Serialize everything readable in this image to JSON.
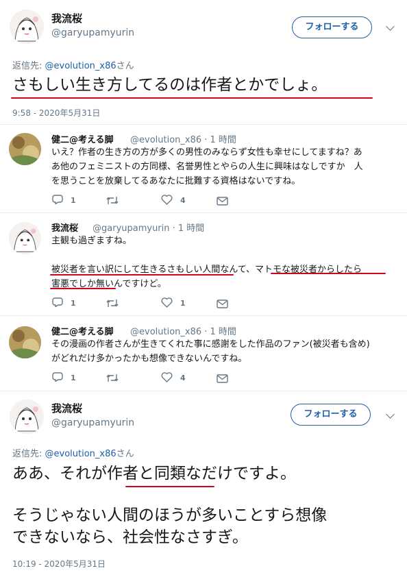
{
  "tweet1": {
    "name": "我流桜",
    "handle": "@garyupamyurin",
    "follow_label": "フォローする",
    "reply_prefix": "返信先: ",
    "reply_mention": "@evolution_x86",
    "reply_suffix": "さん",
    "text": "さもしい生き方してるのは作者とかでしょ。",
    "timestamp": "9:58 - 2020年5月31日"
  },
  "replies": [
    {
      "name": "健二@考える脚",
      "meta": "@evolution_x86 · 1 時間",
      "text": "いえ？作者の生き方の方が多くの男性のみならず女性も幸せにしてますね？あ\nあ他のフェミニストの方同様、名誉男性とやらの人生に興味はなしですか　人\nを思うことを放棄してるあなたに批難する資格はないですね。",
      "reply_count": "1",
      "retweet_count": "",
      "like_count": "4"
    },
    {
      "name": "我流桜",
      "meta": "@garyupamyurin · 1 時間",
      "text": "主観も過ぎますね。\n\n被災者を言い訳にして生きるさもしい人間なんて、マトモな被災者からしたら\n害悪でしか無いんですけど。",
      "reply_count": "1",
      "retweet_count": "",
      "like_count": "1"
    },
    {
      "name": "健二@考える脚",
      "meta": "@evolution_x86 · 1 時間",
      "text": "その漫画の作者さんが生きてくれた事に感謝をした作品のファン(被災者も含め)\nがどれだけ多かったかも想像できないんですね。",
      "reply_count": "1",
      "retweet_count": "",
      "like_count": "4"
    }
  ],
  "tweet2": {
    "name": "我流桜",
    "handle": "@garyupamyurin",
    "follow_label": "フォローする",
    "reply_prefix": "返信先: ",
    "reply_mention": "@evolution_x86",
    "reply_suffix": "さん",
    "text_line1": "ああ、それが作者と同類なだけですよ。",
    "text_line2": "そうじゃない人間のほうが多いことすら想像",
    "text_line3": "できないなら、社会性なさすぎ。",
    "timestamp": "10:19 - 2020年5月31日"
  },
  "colors": {
    "accent": "#1b5ea8",
    "muted": "#657786",
    "annotation_red": "#d0021b"
  },
  "icons": [
    "reply-icon",
    "retweet-icon",
    "like-icon",
    "dm-icon",
    "chevron-down-icon"
  ]
}
